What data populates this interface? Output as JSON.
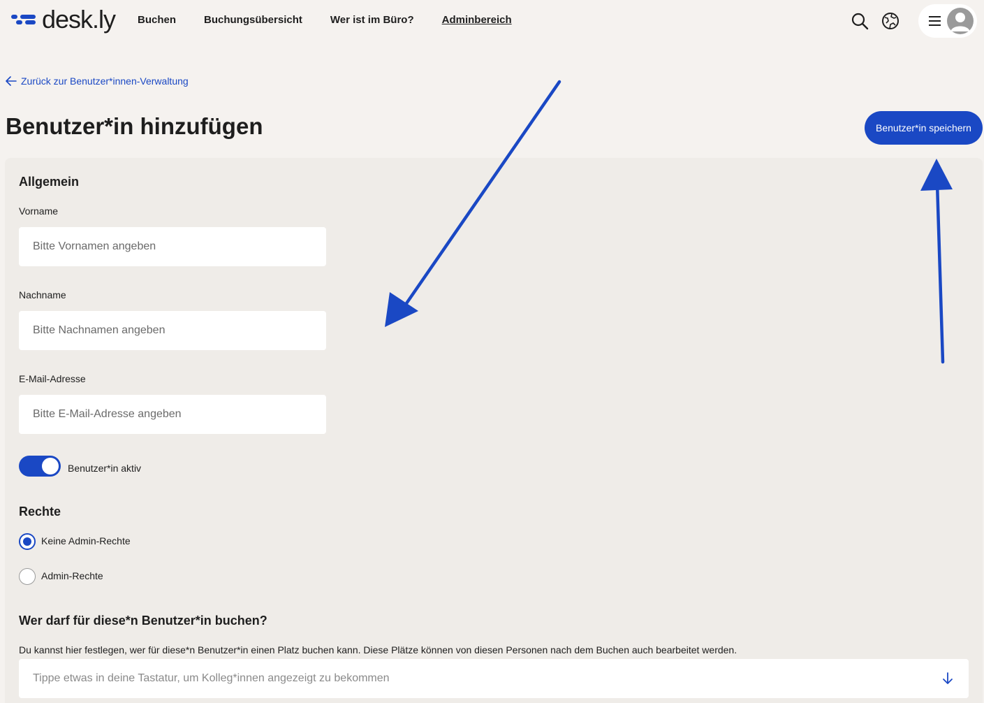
{
  "brand": {
    "name": "desk.ly",
    "accent": "#1a48c4"
  },
  "nav": {
    "items": [
      {
        "label": "Buchen"
      },
      {
        "label": "Buchungsübersicht"
      },
      {
        "label": "Wer ist im Büro?"
      },
      {
        "label": "Adminbereich",
        "active": true
      }
    ]
  },
  "toolbar": {
    "icons": [
      "search-icon",
      "globe-icon",
      "menu-icon",
      "avatar-icon"
    ]
  },
  "back_link": "Zurück zur Benutzer*innen-Verwaltung",
  "page_title": "Benutzer*in hinzufügen",
  "save_button": "Benutzer*in speichern",
  "general": {
    "heading": "Allgemein",
    "first_name": {
      "label": "Vorname",
      "placeholder": "Bitte Vornamen angeben",
      "value": ""
    },
    "last_name": {
      "label": "Nachname",
      "placeholder": "Bitte Nachnamen angeben",
      "value": ""
    },
    "email": {
      "label": "E-Mail-Adresse",
      "placeholder": "Bitte E-Mail-Adresse angeben",
      "value": ""
    },
    "active_toggle": {
      "label": "Benutzer*in aktiv",
      "on": true
    }
  },
  "rights": {
    "heading": "Rechte",
    "options": [
      {
        "label": "Keine Admin-Rechte",
        "selected": true
      },
      {
        "label": "Admin-Rechte",
        "selected": false
      }
    ]
  },
  "booking": {
    "heading": "Wer darf für diese*n Benutzer*in buchen?",
    "description": "Du kannst hier festlegen, wer für diese*n Benutzer*in einen Platz buchen kann. Diese Plätze können von diesen Personen nach dem Buchen auch bearbeitet werden.",
    "placeholder": "Tippe etwas in deine Tastatur, um Kolleg*innen angezeigt zu bekommen"
  }
}
